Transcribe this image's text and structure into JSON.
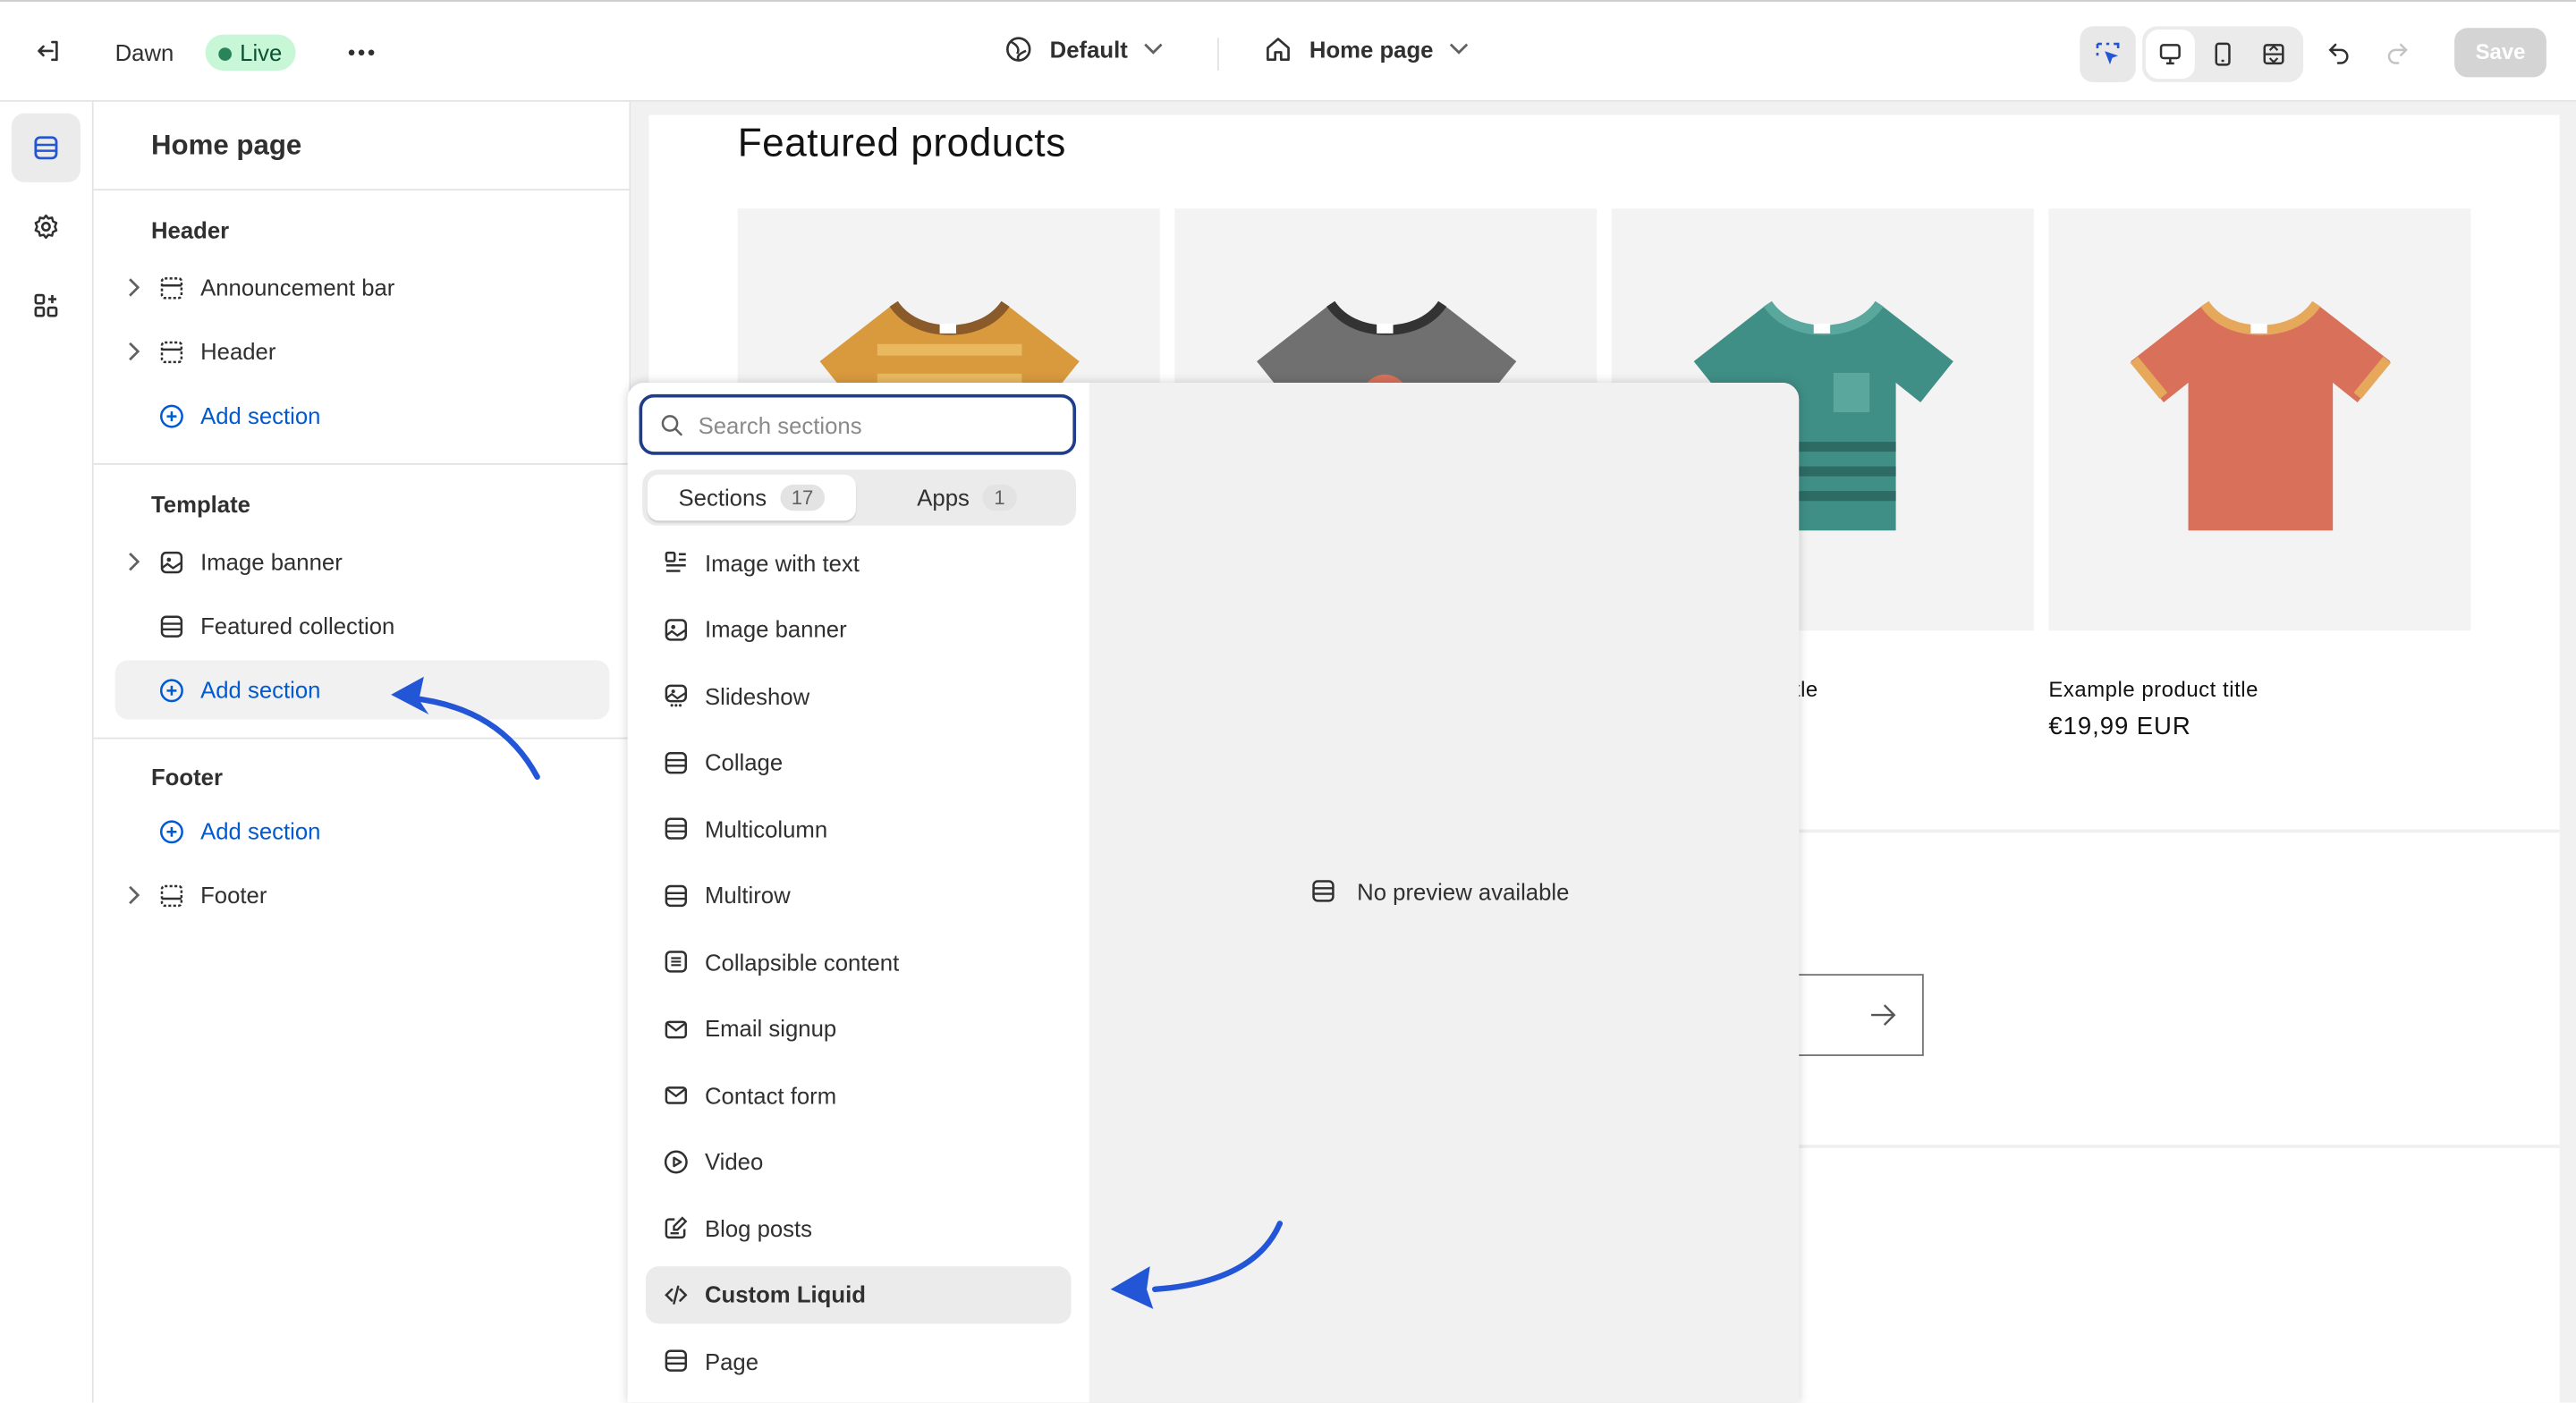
{
  "topbar": {
    "exit_icon": "exit-icon",
    "theme_name": "Dawn",
    "status_badge": "Live",
    "more_icon": "ellipsis-icon",
    "theme_style": "Default",
    "page_selector": "Home page",
    "save_label": "Save"
  },
  "sidebar": {
    "title": "Home page",
    "groups": [
      {
        "heading": "Header",
        "items": [
          {
            "label": "Announcement bar"
          },
          {
            "label": "Header"
          }
        ],
        "add_label": "Add section"
      },
      {
        "heading": "Template",
        "items": [
          {
            "label": "Image banner"
          },
          {
            "label": "Featured collection"
          }
        ],
        "add_label": "Add section"
      },
      {
        "heading": "Footer",
        "items": [
          {
            "label": "Footer"
          }
        ],
        "add_label": "Add section"
      }
    ]
  },
  "preview": {
    "section_title": "Featured products",
    "products": [
      {
        "color": "#d99a3d"
      },
      {
        "color": "#707070"
      },
      {
        "color": "#3f8f86",
        "title_partial": "title"
      },
      {
        "color": "#d8705a",
        "title": "Example product title",
        "price": "€19,99 EUR"
      }
    ]
  },
  "add_section_popover": {
    "search_placeholder": "Search sections",
    "tabs": [
      {
        "label": "Sections",
        "count": "17"
      },
      {
        "label": "Apps",
        "count": "1"
      }
    ],
    "items": [
      {
        "label": "Image with text",
        "icon": "image-with-text-icon"
      },
      {
        "label": "Image banner",
        "icon": "image-icon"
      },
      {
        "label": "Slideshow",
        "icon": "slideshow-icon"
      },
      {
        "label": "Collage",
        "icon": "section-icon"
      },
      {
        "label": "Multicolumn",
        "icon": "section-icon"
      },
      {
        "label": "Multirow",
        "icon": "section-icon"
      },
      {
        "label": "Collapsible content",
        "icon": "collapsible-icon"
      },
      {
        "label": "Email signup",
        "icon": "email-icon"
      },
      {
        "label": "Contact form",
        "icon": "email-icon"
      },
      {
        "label": "Video",
        "icon": "play-icon"
      },
      {
        "label": "Blog posts",
        "icon": "blog-icon"
      },
      {
        "label": "Custom Liquid",
        "icon": "code-icon"
      },
      {
        "label": "Page",
        "icon": "section-icon"
      }
    ],
    "no_preview": "No preview available"
  },
  "annotation_color": "#2356d6"
}
